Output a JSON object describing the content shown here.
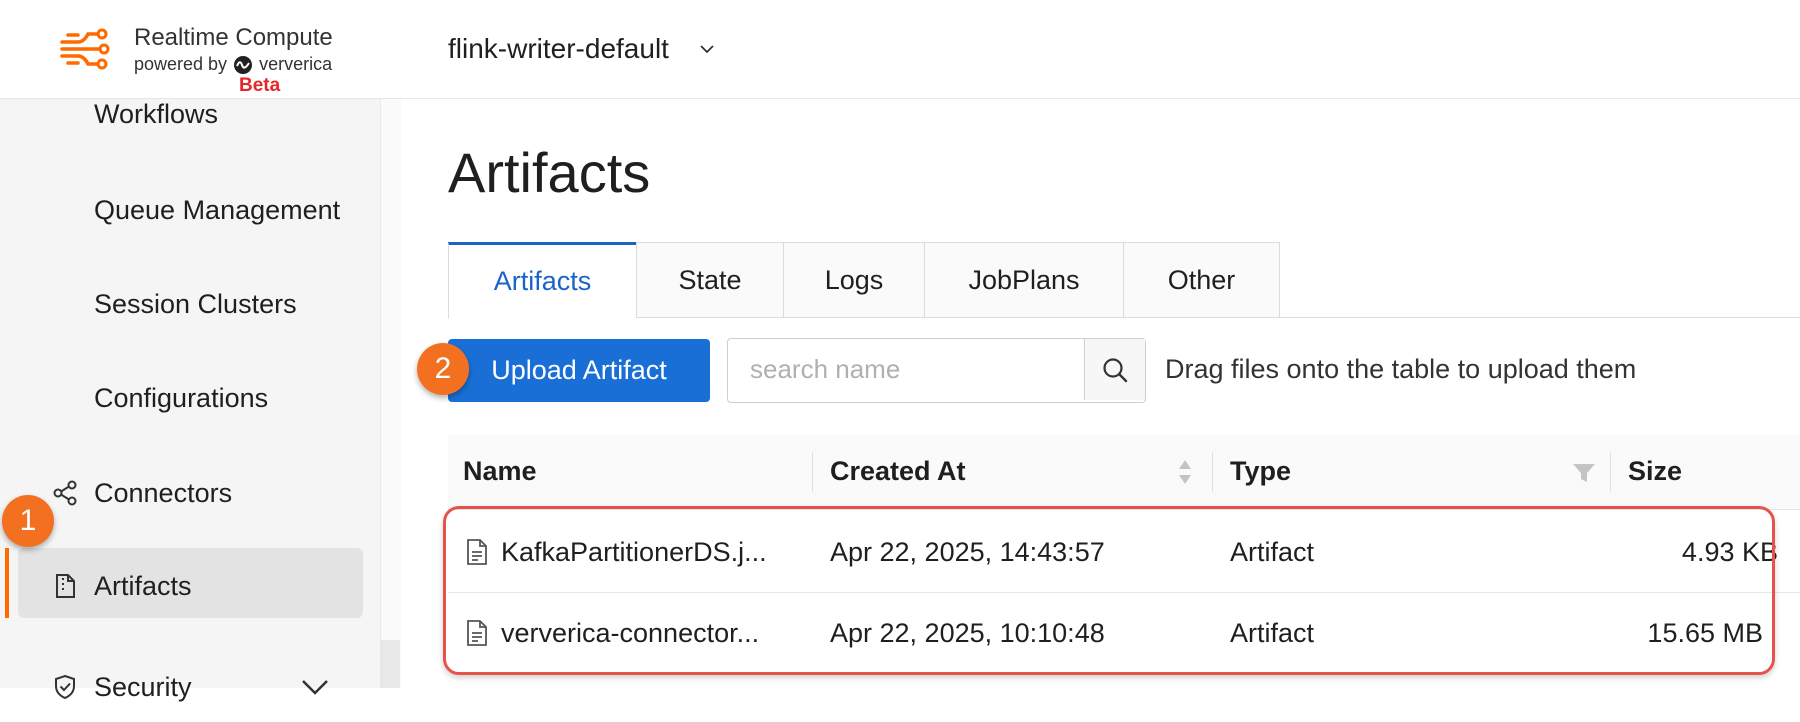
{
  "header": {
    "brand_title": "Realtime Compute",
    "brand_sub_prefix": "powered by",
    "brand_sub_name": "ververica",
    "workspace": "flink-writer-default"
  },
  "sidebar": {
    "items": [
      {
        "label": "Workflows",
        "badge": "Beta"
      },
      {
        "label": "Queue Management"
      },
      {
        "label": "Session Clusters"
      },
      {
        "label": "Configurations"
      },
      {
        "label": "Connectors",
        "icon": "share-nodes-icon"
      },
      {
        "label": "Artifacts",
        "icon": "document-zip-icon",
        "active": true
      },
      {
        "label": "Security",
        "icon": "shield-check-icon",
        "expandable": true
      }
    ]
  },
  "main": {
    "title": "Artifacts",
    "tabs": [
      {
        "label": "Artifacts",
        "active": true
      },
      {
        "label": "State"
      },
      {
        "label": "Logs"
      },
      {
        "label": "JobPlans"
      },
      {
        "label": "Other"
      }
    ],
    "upload_label": "Upload Artifact",
    "search_placeholder": "search name",
    "search_value": "",
    "drag_hint": "Drag files onto the table to upload them",
    "table": {
      "columns": [
        "Name",
        "Created At",
        "Type",
        "Size"
      ],
      "rows": [
        {
          "name": "KafkaPartitionerDS.j...",
          "created": "Apr 22, 2025, 14:43:57",
          "type": "Artifact",
          "size": "4.93 KB"
        },
        {
          "name": "ververica-connector...",
          "created": "Apr 22, 2025, 10:10:48",
          "type": "Artifact",
          "size": "15.65 MB"
        }
      ]
    }
  },
  "annotations": {
    "step1": "1",
    "step2": "2"
  },
  "colors": {
    "accent_blue": "#1a6fd6",
    "brand_orange": "#f37021",
    "highlight_red": "#e5534b",
    "beta_red": "#e5262b"
  }
}
